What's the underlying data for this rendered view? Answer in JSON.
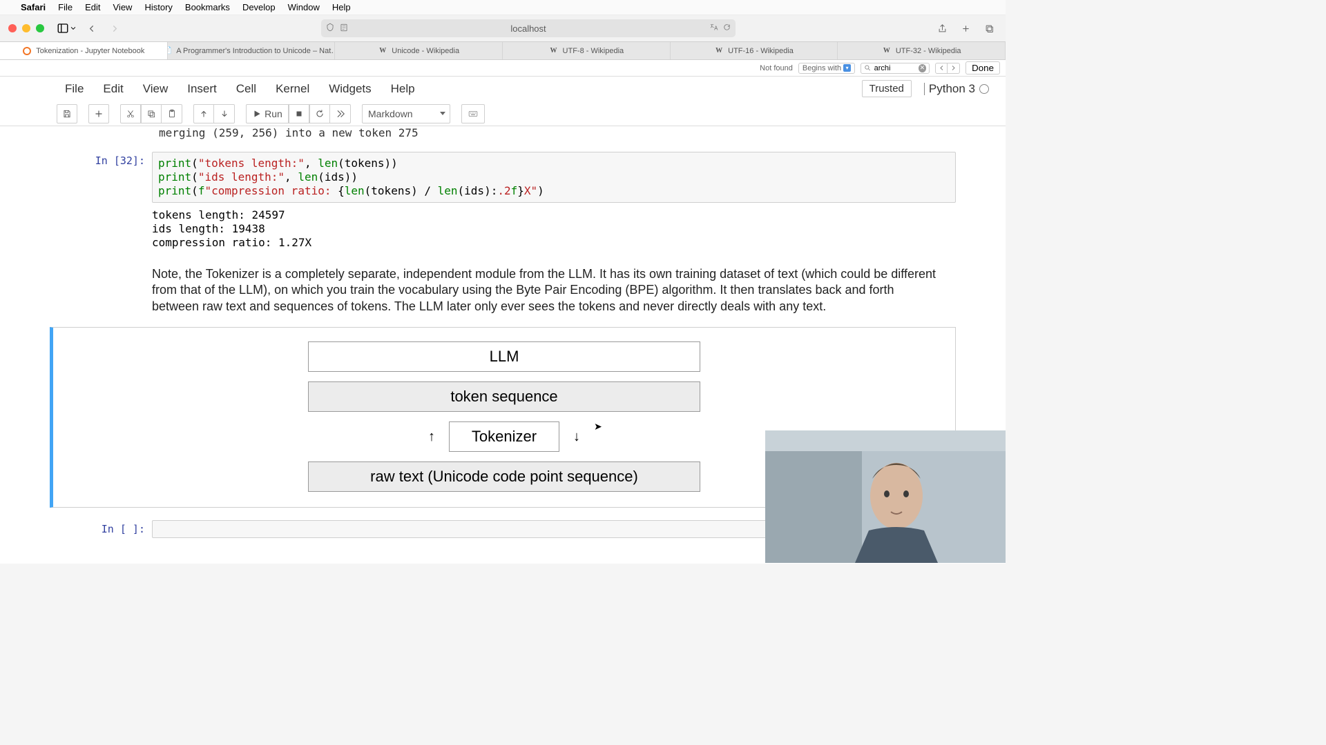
{
  "menubar": {
    "app": "Safari",
    "items": [
      "File",
      "Edit",
      "View",
      "History",
      "Bookmarks",
      "Develop",
      "Window",
      "Help"
    ]
  },
  "address_bar": {
    "host": "localhost"
  },
  "tabs": [
    {
      "label": "Tokenization - Jupyter Notebook",
      "kind": "jupyter",
      "active": true
    },
    {
      "label": "A Programmer's Introduction to Unicode – Nat…",
      "kind": "page"
    },
    {
      "label": "Unicode - Wikipedia",
      "kind": "wiki"
    },
    {
      "label": "UTF-8 - Wikipedia",
      "kind": "wiki"
    },
    {
      "label": "UTF-16 - Wikipedia",
      "kind": "wiki"
    },
    {
      "label": "UTF-32 - Wikipedia",
      "kind": "wiki"
    }
  ],
  "findbar": {
    "not_found": "Not found",
    "begins_with": "Begins with",
    "query": "archi",
    "done": "Done"
  },
  "jupyter": {
    "menu": [
      "File",
      "Edit",
      "View",
      "Insert",
      "Cell",
      "Kernel",
      "Widgets",
      "Help"
    ],
    "trusted": "Trusted",
    "kernel": "Python 3",
    "run_label": "Run",
    "cell_type": "Markdown"
  },
  "notebook": {
    "scroll_line": "merging (259, 256) into a new token 275",
    "code_prompt": "In [32]:",
    "output_lines": [
      "tokens length: 24597",
      "ids length: 19438",
      "compression ratio: 1.27X"
    ],
    "md_paragraph": "Note, the Tokenizer is a completely separate, independent module from the LLM. It has its own training dataset of text (which could be different from that of the LLM), on which you train the vocabulary using the Byte Pair Encoding (BPE) algorithm. It then translates back and forth between raw text and sequences of tokens. The LLM later only ever sees the tokens and never directly deals with any text.",
    "diagram": {
      "llm": "LLM",
      "token_seq": "token sequence",
      "tokenizer": "Tokenizer",
      "raw_text": "raw text (Unicode code point sequence)"
    },
    "empty_prompt": "In [ ]:"
  }
}
